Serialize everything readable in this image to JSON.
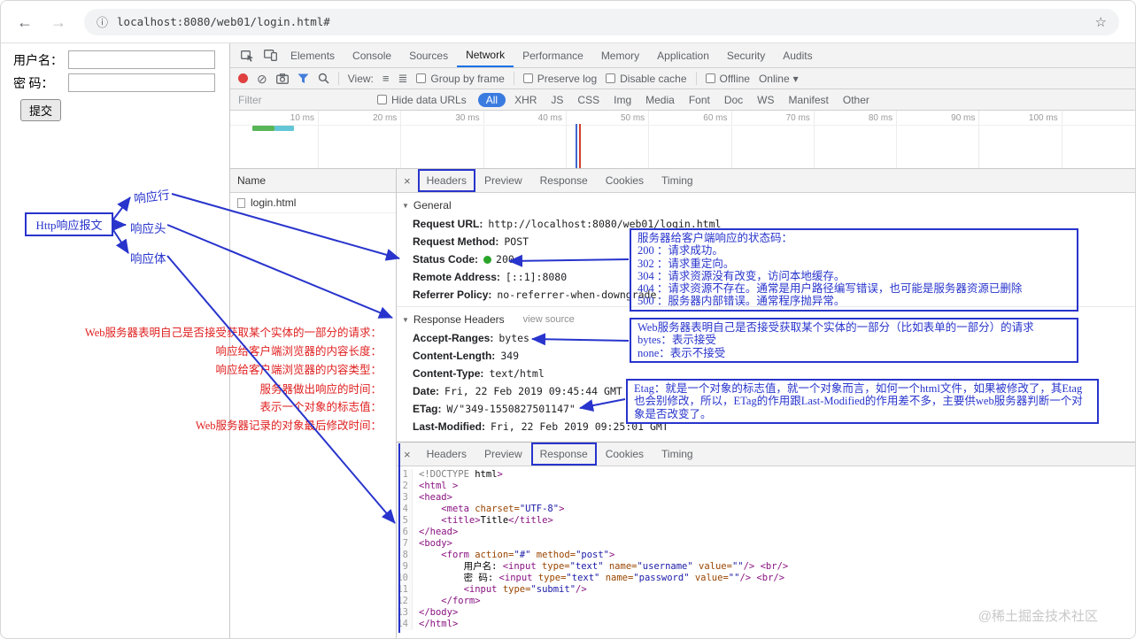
{
  "browser": {
    "url": "localhost:8080/web01/login.html#"
  },
  "icons": {
    "back": "←",
    "forward": "→",
    "info": "ⓘ",
    "star": "☆",
    "close": "×",
    "dropdown": "▾",
    "disclosure": "▼",
    "view_list": "≡",
    "view_large": "≣"
  },
  "page": {
    "username_label": "用户名：",
    "password_label": "密 码：",
    "submit_label": "提交"
  },
  "devtools": {
    "tabs": [
      "Elements",
      "Console",
      "Sources",
      "Network",
      "Performance",
      "Memory",
      "Application",
      "Security",
      "Audits"
    ],
    "active_tab": "Network",
    "toolbar": {
      "view_label": "View:",
      "group_by_frame": "Group by frame",
      "preserve_log": "Preserve log",
      "disable_cache": "Disable cache",
      "offline": "Offline",
      "throttling": "Online"
    },
    "filter": {
      "placeholder": "Filter",
      "hide_data_urls": "Hide data URLs",
      "types": [
        "All",
        "XHR",
        "JS",
        "CSS",
        "Img",
        "Media",
        "Font",
        "Doc",
        "WS",
        "Manifest",
        "Other"
      ],
      "active_type": "All"
    },
    "timeline_ticks": [
      "10 ms",
      "20 ms",
      "30 ms",
      "40 ms",
      "50 ms",
      "60 ms",
      "70 ms",
      "80 ms",
      "90 ms",
      "100 ms"
    ],
    "requests": {
      "name_header": "Name",
      "rows": [
        "login.html"
      ]
    },
    "detail_tabs": [
      "Headers",
      "Preview",
      "Response",
      "Cookies",
      "Timing"
    ],
    "detail_tabs_annotated": "Headers",
    "general": {
      "title": "General",
      "rows": [
        {
          "key": "Request URL:",
          "value": "http://localhost:8080/web01/login.html"
        },
        {
          "key": "Request Method:",
          "value": "POST"
        },
        {
          "key": "Status Code:",
          "value": "200",
          "dot": true
        },
        {
          "key": "Remote Address:",
          "value": "[::1]:8080"
        },
        {
          "key": "Referrer Policy:",
          "value": "no-referrer-when-downgrade"
        }
      ]
    },
    "response_headers": {
      "title": "Response Headers",
      "view_source": "view source",
      "rows": [
        {
          "key": "Accept-Ranges:",
          "value": "bytes"
        },
        {
          "key": "Content-Length:",
          "value": "349"
        },
        {
          "key": "Content-Type:",
          "value": "text/html"
        },
        {
          "key": "Date:",
          "value": "Fri, 22 Feb 2019 09:45:44 GMT"
        },
        {
          "key": "ETag:",
          "value": "W/\"349-1550827501147\""
        },
        {
          "key": "Last-Modified:",
          "value": "Fri, 22 Feb 2019 09:25:01 GMT"
        }
      ]
    },
    "response_panel": {
      "tabs": [
        "Headers",
        "Preview",
        "Response",
        "Cookies",
        "Timing"
      ],
      "annotated_tab": "Response",
      "code_lines": [
        "<!DOCTYPE html>",
        "<html >",
        "<head>",
        "    <meta charset=\"UTF-8\">",
        "    <title>Title</title>",
        "</head>",
        "<body>",
        "    <form action=\"#\" method=\"post\">",
        "        用户名: <input type=\"text\" name=\"username\" value=\"\"/> <br/>",
        "        密 码: <input type=\"text\" name=\"password\" value=\"\"/> <br/>",
        "        <input type=\"submit\"/>",
        "    </form>",
        "</body>",
        "</html>"
      ]
    }
  },
  "annotations": {
    "http_box": "Http响应报文",
    "labels": {
      "line": "响应行",
      "head": "响应头",
      "body": "响应体"
    },
    "status_box_lines": [
      "服务器给客户端响应的状态码：",
      "200 ：请求成功。",
      "302 ：请求重定向。",
      "304 ：请求资源没有改变，访问本地缓存。",
      "404 ：请求资源不存在。通常是用户路径编写错误，也可能是服务器资源已删除",
      "500 ：服务器内部错误。通常程序抛异常。"
    ],
    "accept_box_lines": [
      "Web服务器表明自己是否接受获取某个实体的一部分（比如表单的一部分）的请求",
      "bytes：表示接受",
      "none：表示不接受"
    ],
    "etag_box_text": "Etag：就是一个对象的标志值，就一个对象而言，如何一个html文件，如果被修改了，其Etag也会别修改，所以，ETag的作用跟Last-Modified的作用差不多，主要供web服务器判断一个对象是否改变了。",
    "red_notes": [
      "Web服务器表明自己是否接受获取某个实体的一部分的请求：",
      "响应给客户端浏览器的内容长度：",
      "响应给客户端浏览器的内容类型：",
      "服务器做出响应的时间：",
      "表示一个对象的标志值：",
      "Web服务器记录的对象最后修改时间："
    ]
  },
  "watermark": "@稀土掘金技术社区"
}
